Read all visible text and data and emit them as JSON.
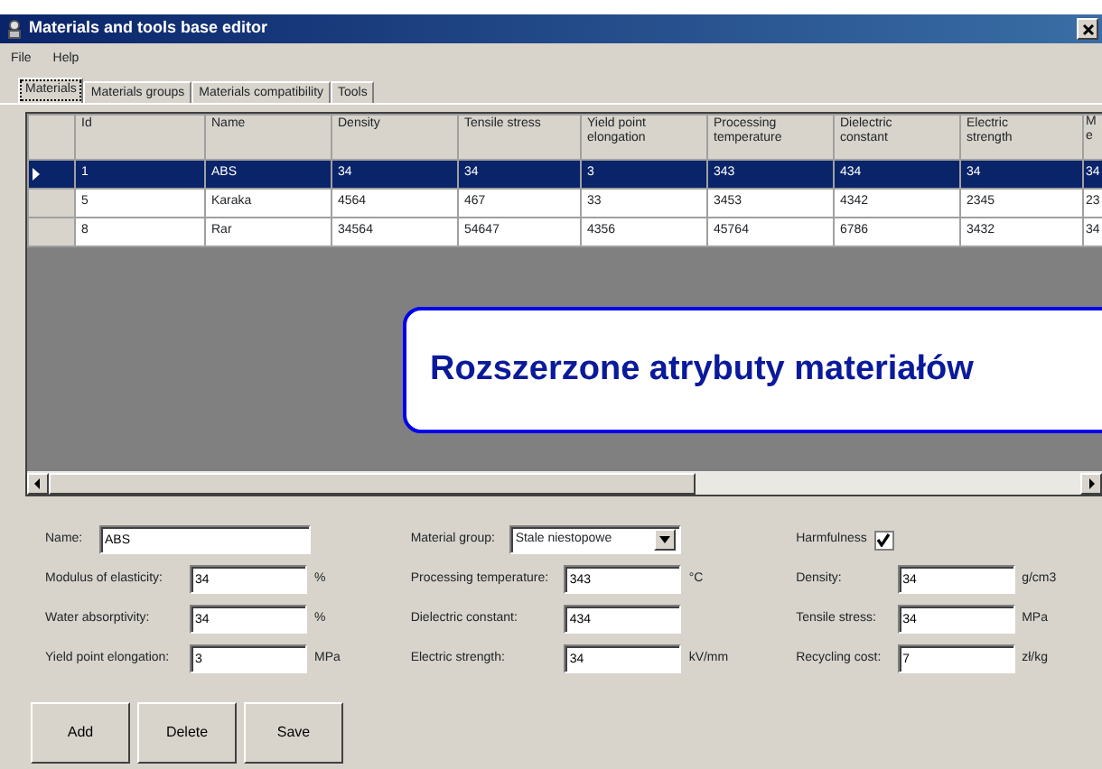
{
  "window": {
    "title": "Materials and tools base editor"
  },
  "menu": [
    "File",
    "Help"
  ],
  "tabs": [
    {
      "label": "Materials",
      "selected": true
    },
    {
      "label": "Materials groups",
      "selected": false
    },
    {
      "label": "Materials compatibility",
      "selected": false
    },
    {
      "label": "Tools",
      "selected": false
    }
  ],
  "table": {
    "columns": [
      "Id",
      "Name",
      "Density",
      "Tensile stress",
      "Yield point elongation",
      "Processing temperature",
      "Dielectric constant",
      "Electric strength",
      "M e"
    ],
    "rows": [
      {
        "selected": true,
        "cells": [
          "1",
          "ABS",
          "34",
          "34",
          "3",
          "343",
          "434",
          "34",
          "34"
        ]
      },
      {
        "selected": false,
        "cells": [
          "5",
          "Karaka",
          "4564",
          "467",
          "33",
          "3453",
          "4342",
          "2345",
          "23"
        ]
      },
      {
        "selected": false,
        "cells": [
          "8",
          "Rar",
          "34564",
          "54647",
          "4356",
          "45764",
          "6786",
          "3432",
          "34"
        ]
      }
    ]
  },
  "callout": "Rozszerzone atrybuty materiałów",
  "form": [
    [
      {
        "kind": "name",
        "label": "Name:",
        "value": "ABS"
      },
      {
        "kind": "text",
        "label": "Modulus of elasticity:",
        "value": "34",
        "unit": "%"
      },
      {
        "kind": "text",
        "label": "Water absorptivity:",
        "value": "34",
        "unit": "%"
      },
      {
        "kind": "text",
        "label": "Yield point elongation:",
        "value": "3",
        "unit": "MPa"
      }
    ],
    [
      {
        "kind": "select",
        "label": "Material group:",
        "value": "Stale niestopowe"
      },
      {
        "kind": "text",
        "label": "Processing temperature:",
        "value": "343",
        "unit": "°C"
      },
      {
        "kind": "text",
        "label": "Dielectric constant:",
        "value": "434"
      },
      {
        "kind": "text",
        "label": "Electric strength:",
        "value": "34",
        "unit": "kV/mm"
      }
    ],
    [
      {
        "kind": "checkbox",
        "label": "Harmfulness",
        "checked": true
      },
      {
        "kind": "text",
        "label": "Density:",
        "value": "34",
        "unit": "g/cm3"
      },
      {
        "kind": "text",
        "label": "Tensile stress:",
        "value": "34",
        "unit": "MPa"
      },
      {
        "kind": "text",
        "label": "Recycling cost:",
        "value": "7",
        "unit": "zł/kg"
      }
    ]
  ],
  "buttons": [
    "Add",
    "Delete",
    "Save"
  ]
}
